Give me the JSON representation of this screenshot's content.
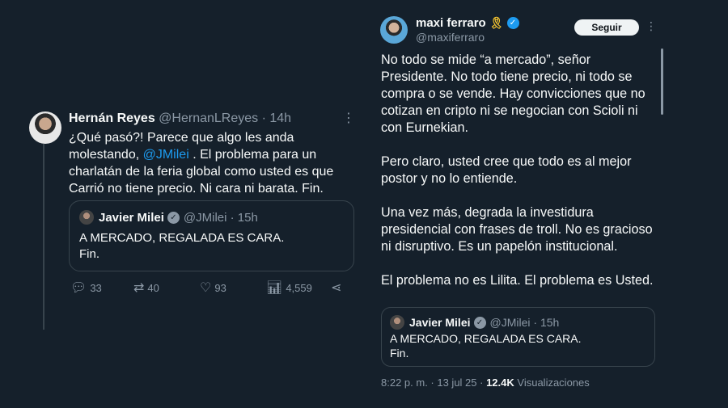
{
  "left_tweet": {
    "author_name": "Hernán Reyes",
    "author_handle": "@HernanLReyes",
    "time": "· 14h",
    "text_before": "¿Qué pasó?! Parece que algo les anda molestando, ",
    "mention": "@JMilei",
    "text_after": " . El problema para un charlatán de la feria global como usted es que Carrió no tiene precio. Ni cara ni barata. Fin.",
    "quoted": {
      "author_name": "Javier Milei",
      "author_handle": "@JMilei",
      "time": "· 15h",
      "line1": "A MERCADO, REGALADA ES CARA.",
      "line2": "Fin."
    },
    "actions": {
      "replies": "33",
      "retweets": "40",
      "likes": "93",
      "views": "4,559"
    }
  },
  "right_tweet": {
    "author_name": "maxi ferraro",
    "author_handle": "@maxiferraro",
    "follow_label": "Seguir",
    "paragraphs": [
      "No todo se mide “a mercado”, señor Presidente. No todo tiene precio, ni todo se compra o se vende. Hay convicciones que no cotizan en cripto ni se negocian con Scioli ni con Eurnekian.",
      "Pero claro, usted cree que todo es al mejor postor y no lo entiende.",
      "Una vez más, degrada la investidura presidencial con frases de troll. No es gracioso ni disruptivo. Es un papelón institucional.",
      "El problema no es Lilita. El problema es Usted."
    ],
    "quoted": {
      "author_name": "Javier Milei",
      "author_handle": "@JMilei",
      "time": "· 15h",
      "line1": "A MERCADO, REGALADA ES CARA.",
      "line2": "Fin."
    },
    "meta": {
      "timestamp": "8:22 p. m. · 13 jul 25 · ",
      "views_count": "12.4K",
      "views_label": " Visualizaciones"
    }
  },
  "colors": {
    "background": "#15202b",
    "text": "#f7f9f9",
    "muted": "#8b98a5",
    "link": "#1d9bf0",
    "border": "#38444d"
  }
}
